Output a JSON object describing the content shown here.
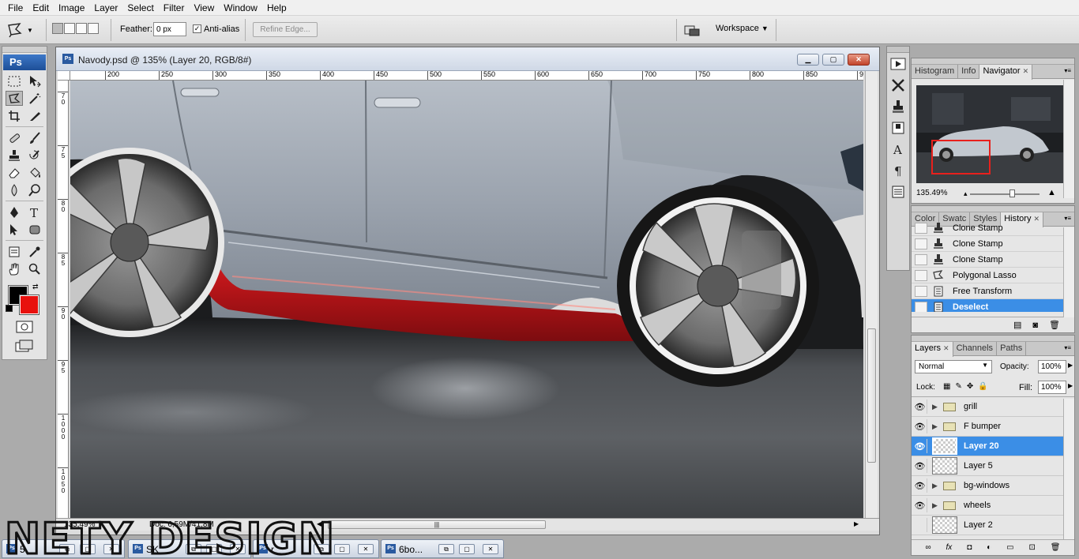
{
  "menu": [
    "File",
    "Edit",
    "Image",
    "Layer",
    "Select",
    "Filter",
    "View",
    "Window",
    "Help"
  ],
  "options_bar": {
    "tool_icon": "polygonal-lasso-icon",
    "feather_label": "Feather:",
    "feather_value": "0 px",
    "antialias_label": "Anti-alias",
    "antialias_checked": true,
    "refine_edge": "Refine Edge...",
    "workspace": "Workspace"
  },
  "tools": {
    "logo": "Ps",
    "foreground_color": "#000000",
    "background_color": "#e8110e"
  },
  "document": {
    "title": "Navody.psd @ 135% (Layer 20, RGB/8#)",
    "ruler_h": [
      "200",
      "250",
      "300",
      "350",
      "400",
      "450",
      "500",
      "550",
      "600",
      "650",
      "700",
      "750",
      "800",
      "850",
      "90"
    ],
    "ruler_v": [
      "7\n0",
      "7\n5",
      "8\n0",
      "8\n5",
      "9\n0",
      "9\n5",
      "1\n0\n0\n0",
      "1\n0\n5\n0",
      "1\n1\n0\n0"
    ],
    "status_zoom": "135,49%",
    "status_doc": "Doc: 6,59M/41,8M"
  },
  "navigator_panel": {
    "tabs": [
      "Histogram",
      "Info",
      "Navigator"
    ],
    "active_tab": "Navigator",
    "zoom": "135.49%"
  },
  "history_panel": {
    "tabs": [
      "Color",
      "Swatc",
      "Styles",
      "History"
    ],
    "active_tab": "History",
    "items": [
      {
        "label": "Clone Stamp",
        "icon": "clone-stamp-icon"
      },
      {
        "label": "Clone Stamp",
        "icon": "clone-stamp-icon"
      },
      {
        "label": "Clone Stamp",
        "icon": "clone-stamp-icon"
      },
      {
        "label": "Polygonal Lasso",
        "icon": "polygonal-lasso-icon"
      },
      {
        "label": "Free Transform",
        "icon": "document-icon"
      },
      {
        "label": "Deselect",
        "icon": "document-icon"
      }
    ],
    "selected": "Deselect"
  },
  "layers_panel": {
    "tabs": [
      "Layers",
      "Channels",
      "Paths"
    ],
    "active_tab": "Layers",
    "blend_mode": "Normal",
    "opacity_label": "Opacity:",
    "opacity": "100%",
    "lock_label": "Lock:",
    "fill_label": "Fill:",
    "fill": "100%",
    "layers": [
      {
        "name": "grill",
        "type": "group",
        "visible": true
      },
      {
        "name": "F bumper",
        "type": "group",
        "visible": true
      },
      {
        "name": "Layer 20",
        "type": "layer",
        "visible": true,
        "selected": true
      },
      {
        "name": "Layer 5",
        "type": "layer",
        "visible": true
      },
      {
        "name": "bg-windows",
        "type": "group",
        "visible": true
      },
      {
        "name": "wheels",
        "type": "group",
        "visible": true
      },
      {
        "name": "Layer 2",
        "type": "layer",
        "visible": false
      }
    ]
  },
  "minimized_docs": [
    {
      "name": "5"
    },
    {
      "name": "SK"
    },
    {
      "name": "r"
    },
    {
      "name": "6bo..."
    }
  ],
  "watermark": "NETY DESIGN",
  "colors": {
    "selection_blue": "#3b8ee6",
    "car_body": "#9aa2ad",
    "side_skirt_red": "#c1161a"
  }
}
